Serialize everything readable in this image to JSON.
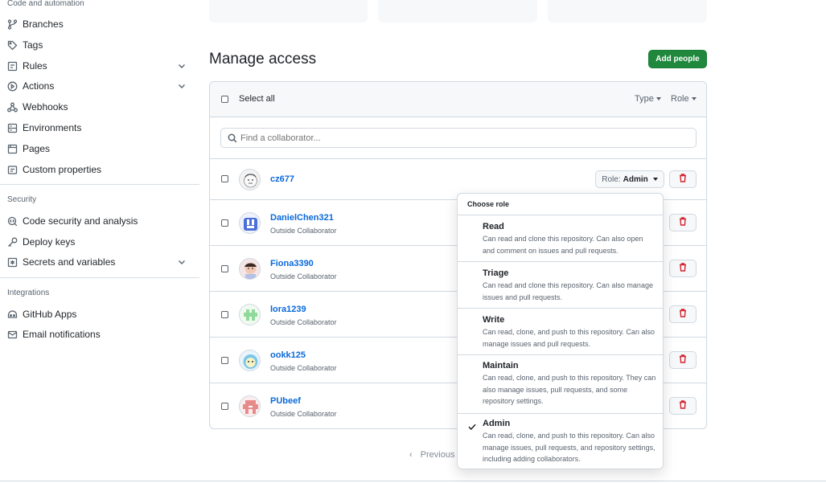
{
  "sidebar": {
    "code_section_title": "Code and automation",
    "items_code": [
      {
        "label": "Branches"
      },
      {
        "label": "Tags"
      },
      {
        "label": "Rules"
      },
      {
        "label": "Actions"
      },
      {
        "label": "Webhooks"
      },
      {
        "label": "Environments"
      },
      {
        "label": "Pages"
      },
      {
        "label": "Custom properties"
      }
    ],
    "security_title": "Security",
    "items_security": [
      {
        "label": "Code security and analysis"
      },
      {
        "label": "Deploy keys"
      },
      {
        "label": "Secrets and variables"
      }
    ],
    "integrations_title": "Integrations",
    "items_integrations": [
      {
        "label": "GitHub Apps"
      },
      {
        "label": "Email notifications"
      }
    ]
  },
  "header": {
    "title": "Manage access",
    "add_button": "Add people"
  },
  "table": {
    "select_all": "Select all",
    "type_filter": "Type",
    "role_filter": "Role",
    "search_placeholder": "Find a collaborator...",
    "rows": [
      {
        "name": "cz677",
        "subtitle": "",
        "role_prefix": "Role:",
        "role": "Admin"
      },
      {
        "name": "DanielChen321",
        "subtitle": "Outside Collaborator"
      },
      {
        "name": "Fiona3390",
        "subtitle": "Outside Collaborator"
      },
      {
        "name": "lora1239",
        "subtitle": "Outside Collaborator"
      },
      {
        "name": "ookk125",
        "subtitle": "Outside Collaborator"
      },
      {
        "name": "PUbeef",
        "subtitle": "Outside Collaborator"
      }
    ]
  },
  "pagination": {
    "previous": "Previous"
  },
  "role_menu": {
    "title": "Choose role",
    "selected": "Admin",
    "options": [
      {
        "name": "Read",
        "desc": "Can read and clone this repository. Can also open and comment on issues and pull requests."
      },
      {
        "name": "Triage",
        "desc": "Can read and clone this repository. Can also manage issues and pull requests."
      },
      {
        "name": "Write",
        "desc": "Can read, clone, and push to this repository. Can also manage issues and pull requests."
      },
      {
        "name": "Maintain",
        "desc": "Can read, clone, and push to this repository. They can also manage issues, pull requests, and some repository settings."
      },
      {
        "name": "Admin",
        "desc": "Can read, clone, and push to this repository. Can also manage issues, pull requests, and repository settings, including adding collaborators."
      }
    ]
  },
  "colors": {
    "accent_green": "#1f883d",
    "link_blue": "#0969da",
    "danger_red": "#d1242f"
  }
}
